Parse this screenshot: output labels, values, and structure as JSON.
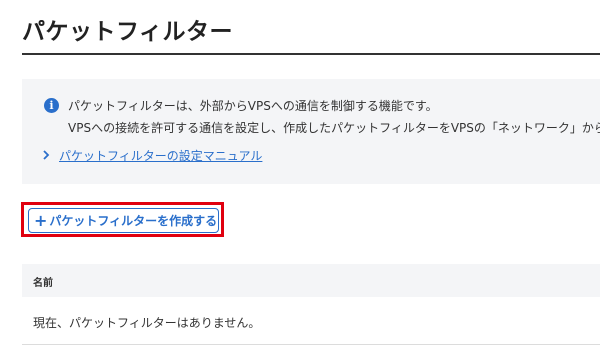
{
  "page": {
    "title": "パケットフィルター"
  },
  "info": {
    "icon": "info-icon",
    "line1": "パケットフィルターは、外部からVPSへの通信を制御する機能です。",
    "line2": "VPSへの接続を許可する通信を設定し、作成したパケットフィルターをVPSの「ネットワーク」から",
    "manual_link": "パケットフィルターの設定マニュアル"
  },
  "actions": {
    "create_label": "パケットフィルターを作成する"
  },
  "table": {
    "columns": [
      "名前"
    ],
    "empty_message": "現在、パケットフィルターはありません。"
  },
  "colors": {
    "accent": "#2a6fcb",
    "highlight": "#e0000f",
    "panel": "#f4f5f7"
  }
}
